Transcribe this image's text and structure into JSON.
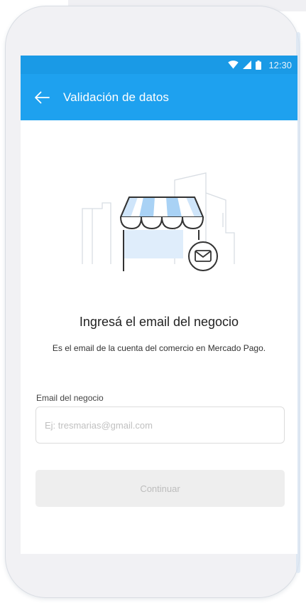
{
  "status_bar": {
    "time": "12:30",
    "icons": [
      "wifi-icon",
      "signal-icon",
      "battery-icon"
    ]
  },
  "app_bar": {
    "title": "Validación de datos",
    "back_icon": "arrow-left-icon"
  },
  "illustration": {
    "icon": "store-with-email-icon"
  },
  "content": {
    "heading": "Ingresá el email del negocio",
    "subtext": "Es el email de la cuenta del comercio en Mercado Pago."
  },
  "form": {
    "email_label": "Email del negocio",
    "email_placeholder": "Ej: tresmarias@gmail.com",
    "email_value": ""
  },
  "actions": {
    "continue_label": "Continuar"
  },
  "colors": {
    "status_bar": "#1a9ae6",
    "app_bar": "#1ea1ef",
    "awning_blue": "#b7d8f5",
    "button_disabled_bg": "#eeeeee",
    "button_disabled_text": "#bdbdbd"
  }
}
